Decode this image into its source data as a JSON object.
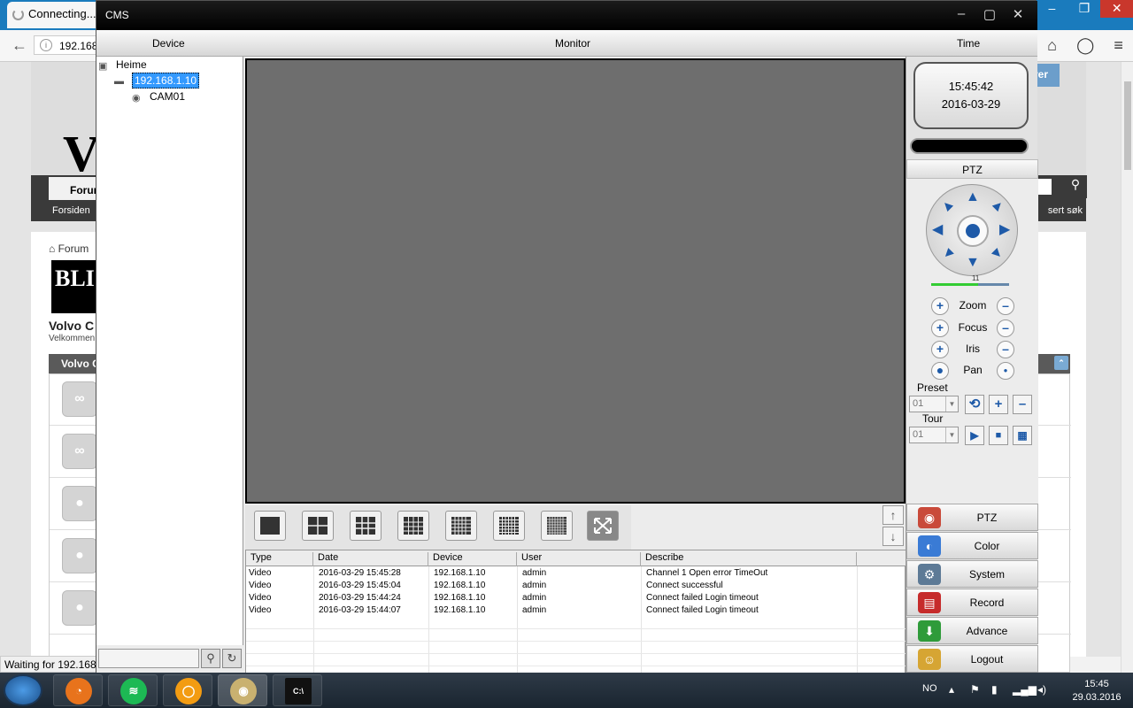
{
  "browser": {
    "tab_title": "Connecting...",
    "address": "192.168.",
    "status_text": "Waiting for 192.168.",
    "hero_text": "Vo",
    "nav_forum": "Forum",
    "nav_forsiden": "Forsiden",
    "nav_sok": "sert søk",
    "register_btn": "rer",
    "breadcrumb": "Forum",
    "banner_text": "BLI M",
    "section_title": "Volvo C",
    "section_welcome": "Velkommen",
    "forum_header": "Volvo C",
    "collapse_icon": "⌃"
  },
  "cms": {
    "title": "CMS",
    "menu": {
      "device": "Device",
      "monitor": "Monitor",
      "time": "Time"
    },
    "tree": {
      "root": "Heime",
      "device": "192.168.1.10",
      "camera": "CAM01"
    },
    "clock": {
      "time": "15:45:42",
      "date": "2016-03-29"
    },
    "ptz": {
      "title": "PTZ",
      "speed": "11",
      "zoom": "Zoom",
      "focus": "Focus",
      "iris": "Iris",
      "pan": "Pan",
      "preset_label": "Preset",
      "preset_value": "01",
      "tour_label": "Tour",
      "tour_value": "01"
    },
    "side_menu": [
      {
        "label": "PTZ",
        "icon": "ptz-icon",
        "color": "#c94a3a"
      },
      {
        "label": "Color",
        "icon": "color-icon",
        "color": "#3a7bd5"
      },
      {
        "label": "System",
        "icon": "system-icon",
        "color": "#5d7a96"
      },
      {
        "label": "Record",
        "icon": "record-icon",
        "color": "#c62b2b"
      },
      {
        "label": "Advance",
        "icon": "advance-icon",
        "color": "#2f9b3a"
      },
      {
        "label": "Logout",
        "icon": "logout-icon",
        "color": "#d6a533"
      }
    ],
    "log": {
      "columns": [
        "Type",
        "Date",
        "Device",
        "User",
        "Describe"
      ],
      "rows": [
        [
          "Video",
          "2016-03-29 15:45:28",
          "192.168.1.10",
          "admin",
          "Channel 1 Open error TimeOut"
        ],
        [
          "Video",
          "2016-03-29 15:45:04",
          "192.168.1.10",
          "admin",
          "Connect successful"
        ],
        [
          "Video",
          "2016-03-29 15:44:24",
          "192.168.1.10",
          "admin",
          "Connect failed Login timeout"
        ],
        [
          "Video",
          "2016-03-29 15:44:07",
          "192.168.1.10",
          "admin",
          "Connect failed Login timeout"
        ]
      ]
    }
  },
  "taskbar": {
    "language": "NO",
    "time": "15:45",
    "date": "29.03.2016",
    "apps": [
      "firefox-icon",
      "spotify-icon",
      "vlc-icon",
      "cms-icon",
      "cmd-icon"
    ]
  }
}
